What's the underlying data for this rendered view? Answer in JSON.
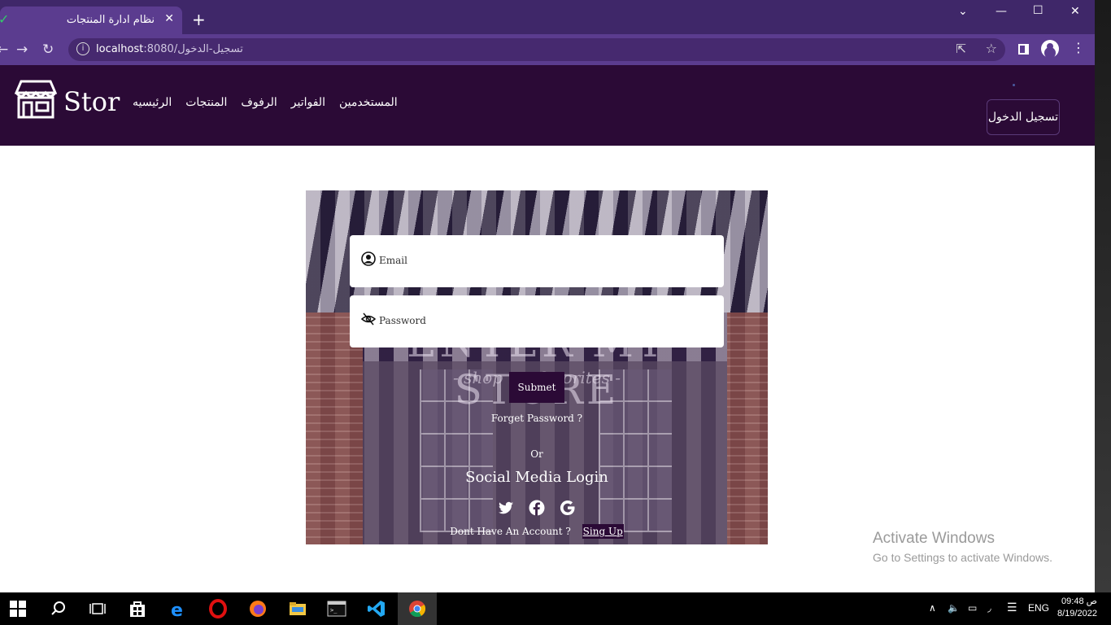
{
  "browser": {
    "tab_title": "نظام ادارة المنتجات",
    "url_host": "localhost",
    "url_path": ":8080/تسجيل-الدخول"
  },
  "site": {
    "logo_text": "Stor",
    "nav": [
      "المستخدمين",
      "الفواتير",
      "الرفوف",
      "المنتجات",
      "الرئيسيه"
    ],
    "login_button": "تسجيل الدخول"
  },
  "login_form": {
    "email_placeholder": "Email",
    "password_placeholder": "Password",
    "submit_label": "Submet",
    "forget_password": "Forget Password ?",
    "or_text": "Or",
    "social_title": "Social Media Login",
    "no_account_text": "Dont Have An Account ?",
    "signup_link": "Sing Up"
  },
  "background_sign": {
    "big": "ENTER MY STORE",
    "small": "- shop my favorites -"
  },
  "watermark": {
    "line1": "Activate Windows",
    "line2": "Go to Settings to activate Windows."
  },
  "taskbar": {
    "language": "ENG",
    "time": "09:48 ص",
    "date": "8/19/2022"
  },
  "colors": {
    "header_bg": "#2b0a36",
    "browser_accent": "#5b3c8f"
  }
}
